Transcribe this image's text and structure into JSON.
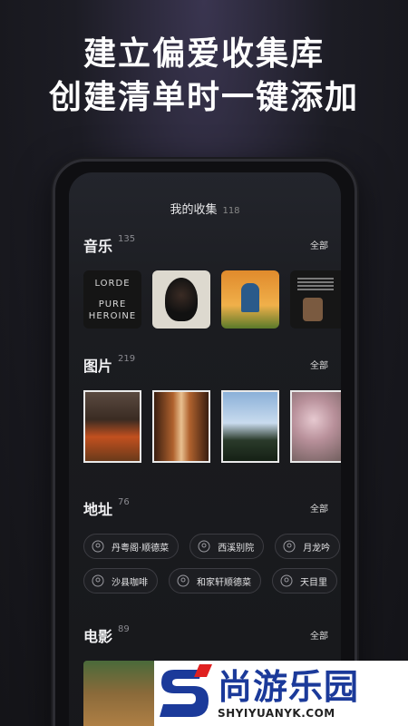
{
  "headline": {
    "line1": "建立偏爱收集库",
    "line2": "创建清单时一键添加"
  },
  "screen": {
    "title": "我的收集",
    "total_count": "118"
  },
  "sections": {
    "music": {
      "title": "音乐",
      "count": "135",
      "all_label": "全部",
      "albums": [
        {
          "icon": "lorde-pure-heroine-cover",
          "lines": [
            "LORDE",
            "PURE",
            "HEROINE"
          ]
        },
        {
          "icon": "portrait-album-cover"
        },
        {
          "icon": "sunflower-album-cover"
        },
        {
          "icon": "dark-album-cover"
        }
      ]
    },
    "pictures": {
      "title": "图片",
      "count": "219",
      "all_label": "全部",
      "photos": [
        {
          "icon": "red-car-sculpture-photo"
        },
        {
          "icon": "wooden-interior-photo"
        },
        {
          "icon": "buildings-sky-photo"
        },
        {
          "icon": "cherry-blossom-photo"
        }
      ]
    },
    "places": {
      "title": "地址",
      "count": "76",
      "all_label": "全部",
      "row1": [
        "丹粤阁·顺德菜",
        "西溪别院",
        "月龙吟"
      ],
      "row2": [
        "沙县咖啡",
        "和家轩顺德菜",
        "天目里"
      ]
    },
    "movies": {
      "title": "电影",
      "count": "89",
      "all_label": "全部",
      "posters": [
        {
          "icon": "movie-poster-1"
        },
        {
          "icon": "movie-poster-2"
        },
        {
          "icon": "movie-poster-3"
        }
      ]
    }
  },
  "watermark": {
    "name": "尚游乐园",
    "url": "SHYIYUANYK.COM"
  },
  "colors": {
    "background": "#1c1c24",
    "watermark_blue": "#1b3a9a",
    "watermark_red": "#e02020"
  }
}
